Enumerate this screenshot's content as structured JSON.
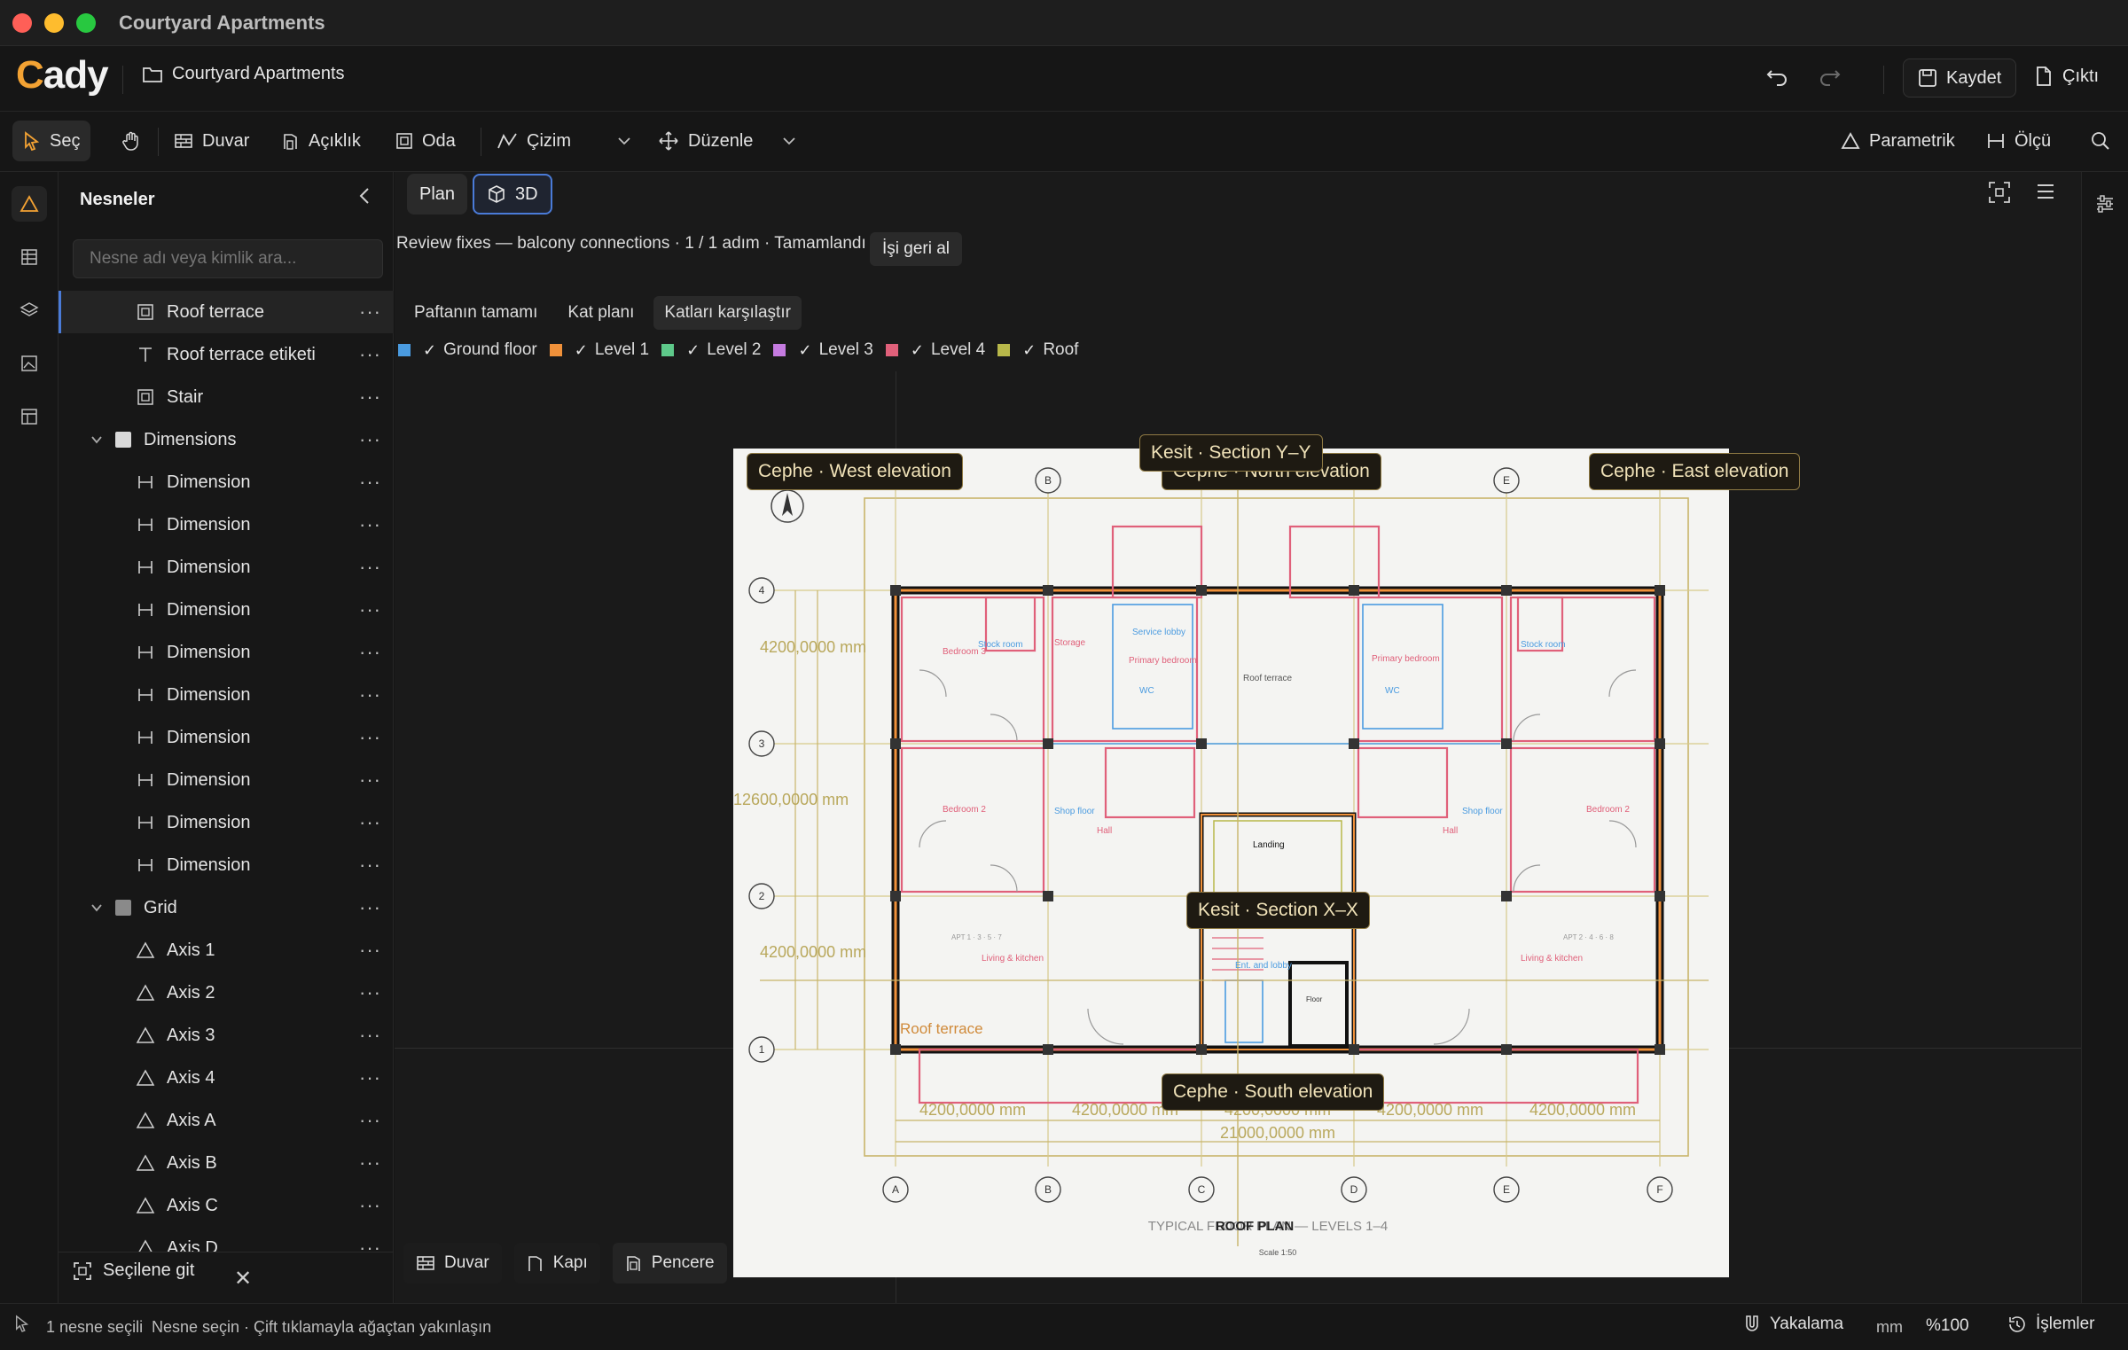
{
  "window": {
    "title": "Courtyard Apartments"
  },
  "header": {
    "logo": "Cady",
    "project_name": "Courtyard Apartments",
    "save_label": "Kaydet",
    "export_label": "Çıktı"
  },
  "toolbar": {
    "select": "Seç",
    "wall": "Duvar",
    "opening": "Açıklık",
    "room": "Oda",
    "draw": "Çizim",
    "edit": "Düzenle",
    "parametric": "Parametrik",
    "measure": "Ölçü"
  },
  "panel": {
    "title": "Nesneler",
    "search_placeholder": "Nesne adı veya kimlik ara...",
    "items": [
      {
        "label": "Roof terrace",
        "icon": "room-icon",
        "selected": true
      },
      {
        "label": "Roof terrace etiketi",
        "icon": "text-icon"
      },
      {
        "label": "Stair",
        "icon": "room-icon"
      },
      {
        "label": "Dimensions",
        "icon": "group",
        "group": true,
        "color": "#d9d9d9"
      },
      {
        "label": "Dimension",
        "icon": "dimension-icon"
      },
      {
        "label": "Dimension",
        "icon": "dimension-icon"
      },
      {
        "label": "Dimension",
        "icon": "dimension-icon"
      },
      {
        "label": "Dimension",
        "icon": "dimension-icon"
      },
      {
        "label": "Dimension",
        "icon": "dimension-icon"
      },
      {
        "label": "Dimension",
        "icon": "dimension-icon"
      },
      {
        "label": "Dimension",
        "icon": "dimension-icon"
      },
      {
        "label": "Dimension",
        "icon": "dimension-icon"
      },
      {
        "label": "Dimension",
        "icon": "dimension-icon"
      },
      {
        "label": "Dimension",
        "icon": "dimension-icon"
      },
      {
        "label": "Grid",
        "icon": "group",
        "group": true,
        "color": "#8a8a8a"
      },
      {
        "label": "Axis 1",
        "icon": "axis-icon"
      },
      {
        "label": "Axis 2",
        "icon": "axis-icon"
      },
      {
        "label": "Axis 3",
        "icon": "axis-icon"
      },
      {
        "label": "Axis 4",
        "icon": "axis-icon"
      },
      {
        "label": "Axis A",
        "icon": "axis-icon"
      },
      {
        "label": "Axis B",
        "icon": "axis-icon"
      },
      {
        "label": "Axis C",
        "icon": "axis-icon"
      },
      {
        "label": "Axis D",
        "icon": "axis-icon"
      }
    ],
    "goto_selected": "Seçilene git"
  },
  "canvas": {
    "view_tabs": {
      "plan": "Plan",
      "three_d": "3D"
    },
    "review_text": "Review fixes — balcony connections · 1 / 1 adım · Tamamlandı",
    "undo_job": "İşi geri al",
    "sheet_tabs": [
      "Paftanın tamamı",
      "Kat planı",
      "Katları karşılaştır"
    ],
    "active_sheet_tab": 2,
    "levels": [
      {
        "name": "Ground floor",
        "color": "#4a9be0"
      },
      {
        "name": "Level 1",
        "color": "#f0913a"
      },
      {
        "name": "Level 2",
        "color": "#5ec98a"
      },
      {
        "name": "Level 3",
        "color": "#c57be0"
      },
      {
        "name": "Level 4",
        "color": "#e0607a"
      },
      {
        "name": "Roof",
        "color": "#b8b84a"
      }
    ],
    "tags": {
      "west": "Cephe · West elevation",
      "north": "Cephe · North elevation",
      "east": "Cephe · East elevation",
      "section_y": "Kesit · Section Y–Y",
      "section_x": "Kesit · Section X–X",
      "south": "Cephe · South elevation"
    },
    "drawing": {
      "title": "TYPICAL FLOOR PLAN — LEVELS 1–4",
      "overlay_title": "ROOF PLAN",
      "scale": "Scale 1:50",
      "grid_cols": [
        "A",
        "B",
        "C",
        "D",
        "E",
        "F"
      ],
      "grid_rows": [
        "1",
        "2",
        "3",
        "4"
      ],
      "dim_h": "4200,0000 mm",
      "dim_total": "21000,0000 mm",
      "dim_v": "4200,0000 mm",
      "dim_v_total": "12600,0000 mm",
      "roof_label": "Roof terrace",
      "rooms": {
        "bedroom3_l": "Bedroom 3",
        "stock_room": "Stock room",
        "storage": "Storage",
        "service_lobby": "Service lobby",
        "primary_bedroom": "Primary bedroom",
        "roof_terrace": "Roof terrace",
        "bedroom2": "Bedroom 2",
        "shop_floor": "Shop floor",
        "hall": "Hall",
        "landing": "Landing",
        "living": "Living & kitchen",
        "wc": "WC",
        "apt_l": "APT 1 · 3 · 5 · 7",
        "apt_r": "APT 2 · 4 · 6 · 8",
        "entry": "Ent. and lobby",
        "floor": "Floor"
      }
    },
    "bottom": {
      "wall": "Duvar",
      "door": "Kapı",
      "window": "Pencere"
    }
  },
  "status": {
    "selection": "1 nesne seçili",
    "hint": "Nesne seçin · Çift tıklamayla ağaçtan yakınlaşın",
    "snap": "Yakalama",
    "unit": "mm",
    "zoom": "%100",
    "history": "İşlemler"
  }
}
